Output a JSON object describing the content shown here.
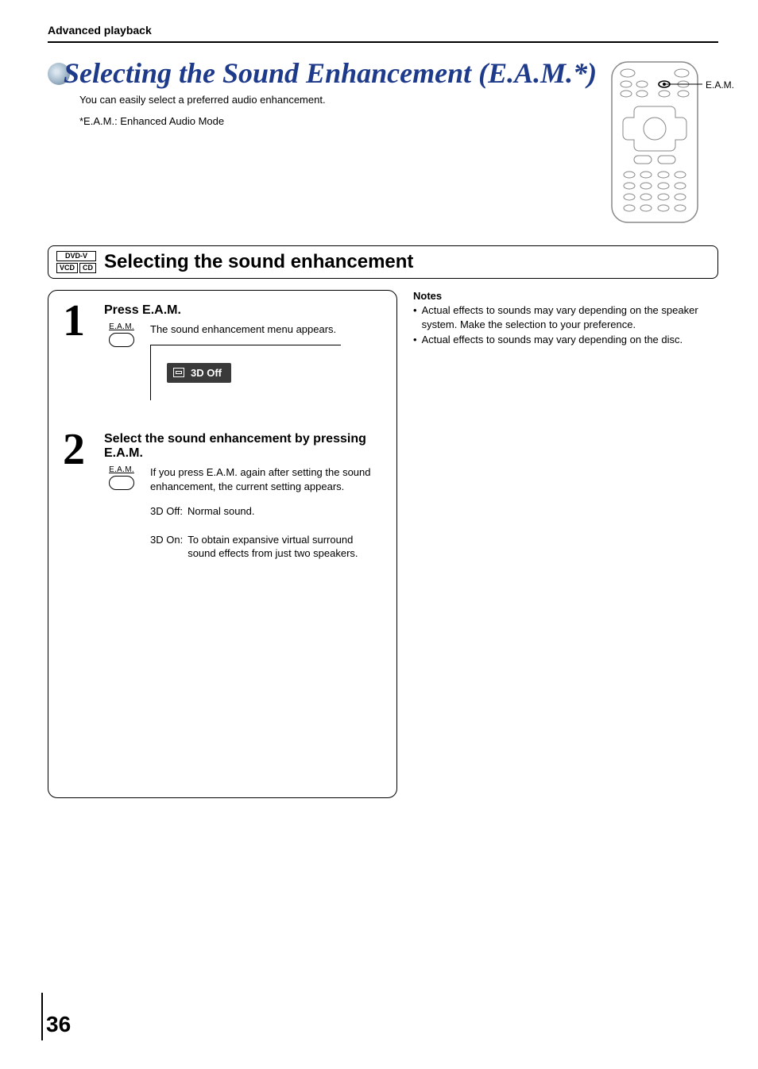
{
  "breadcrumb": "Advanced playback",
  "title": "Selecting the Sound Enhancement (E.A.M.*)",
  "intro": "You can easily select a preferred audio enhancement.",
  "footnote": "*E.A.M.: Enhanced Audio Mode",
  "remote_label": "E.A.M.",
  "badges": {
    "a": "DVD-V",
    "b": "VCD",
    "c": "CD"
  },
  "section_title": "Selecting the sound enhancement",
  "step1": {
    "num": "1",
    "title": "Press E.A.M.",
    "button_label": "E.A.M.",
    "text": "The sound enhancement menu appears.",
    "osd": "3D  Off"
  },
  "step2": {
    "num": "2",
    "title": "Select the sound enhancement by pressing E.A.M.",
    "button_label": "E.A.M.",
    "text": "If you press E.A.M. again after setting the sound enhancement, the current setting appears.",
    "opts": {
      "off_k": "3D Off:",
      "off_v": "Normal sound.",
      "on_k": "3D On:",
      "on_v": "To obtain expansive virtual surround sound effects from just two speakers."
    }
  },
  "notes": {
    "heading": "Notes",
    "items": [
      "Actual effects to sounds may vary depending on the speaker system.  Make the selection to your preference.",
      "Actual effects to sounds may vary depending on the disc."
    ]
  },
  "page_number": "36"
}
